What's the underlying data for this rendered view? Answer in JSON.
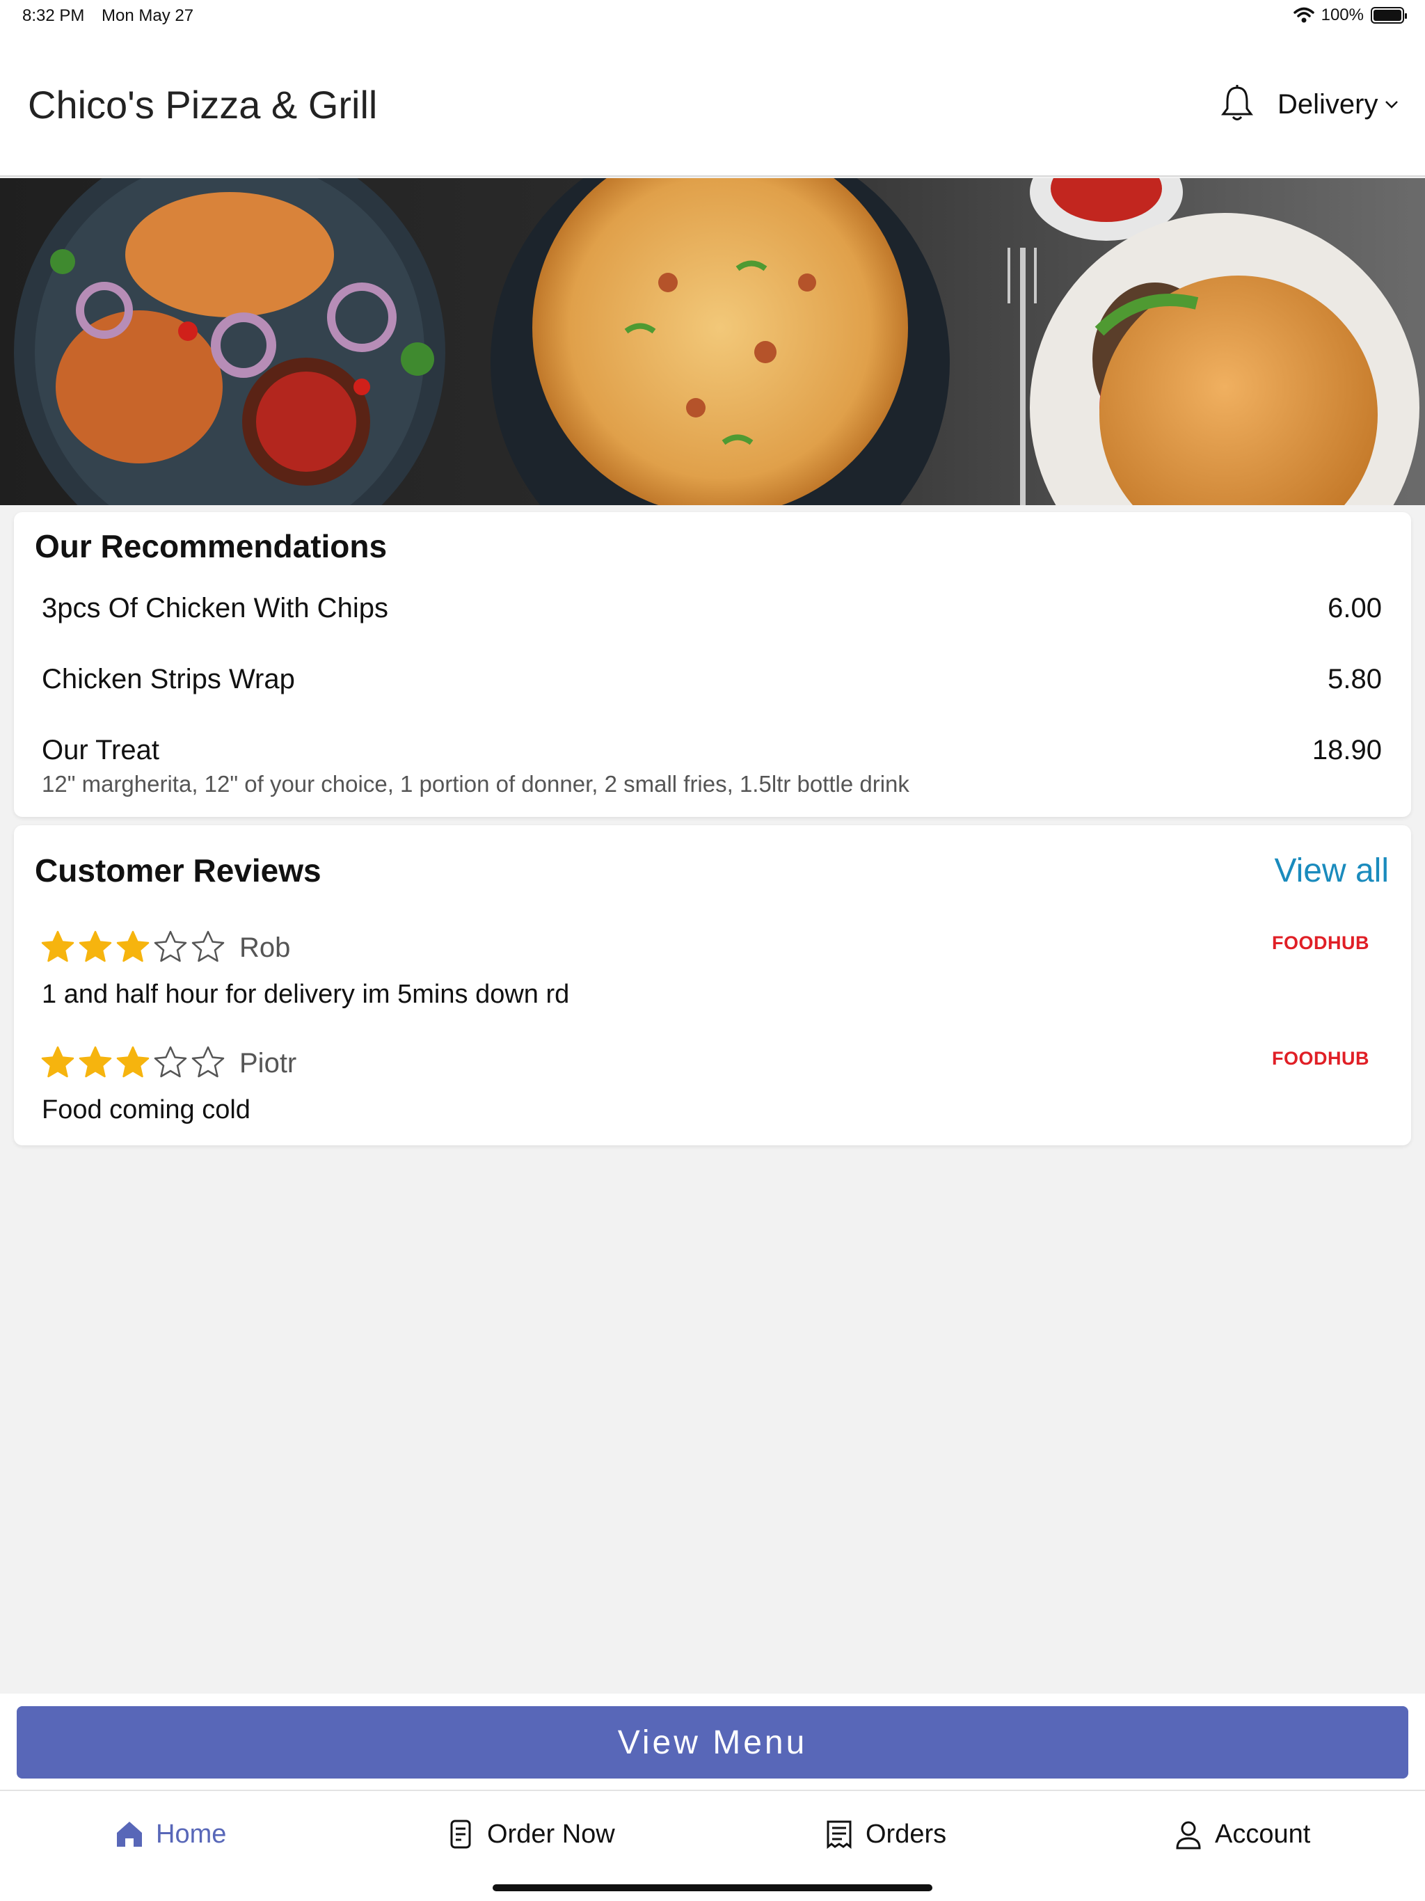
{
  "status_bar": {
    "time": "8:32 PM",
    "date": "Mon May 27",
    "battery": "100%"
  },
  "header": {
    "title": "Chico's Pizza & Grill",
    "delivery_label": "Delivery"
  },
  "recommendations": {
    "title": "Our Recommendations",
    "items": [
      {
        "name": "3pcs Of Chicken With Chips",
        "price": "6.00"
      },
      {
        "name": "Chicken Strips Wrap",
        "price": "5.80"
      },
      {
        "name": "Our Treat",
        "price": "18.90",
        "description": "12\" margherita, 12\" of your choice, 1 portion of donner, 2 small fries, 1.5ltr bottle drink"
      }
    ]
  },
  "reviews": {
    "title": "Customer Reviews",
    "view_all": "View all",
    "items": [
      {
        "name": "Rob",
        "rating": 3,
        "max_rating": 5,
        "text": "1 and half hour for delivery im 5mins down rd",
        "source": "FOODHUB"
      },
      {
        "name": "Piotr",
        "rating": 3,
        "max_rating": 5,
        "text": "Food coming cold",
        "source": "FOODHUB"
      }
    ]
  },
  "view_menu": "View Menu",
  "tabs": [
    {
      "label": "Home",
      "icon": "home-icon",
      "active": true
    },
    {
      "label": "Order Now",
      "icon": "order-now-icon",
      "active": false
    },
    {
      "label": "Orders",
      "icon": "receipt-icon",
      "active": false
    },
    {
      "label": "Account",
      "icon": "user-icon",
      "active": false
    }
  ],
  "colors": {
    "accent": "#5867b8",
    "link": "#1a8bbd",
    "star": "#f6b40e",
    "foodhub": "#e01f26"
  }
}
